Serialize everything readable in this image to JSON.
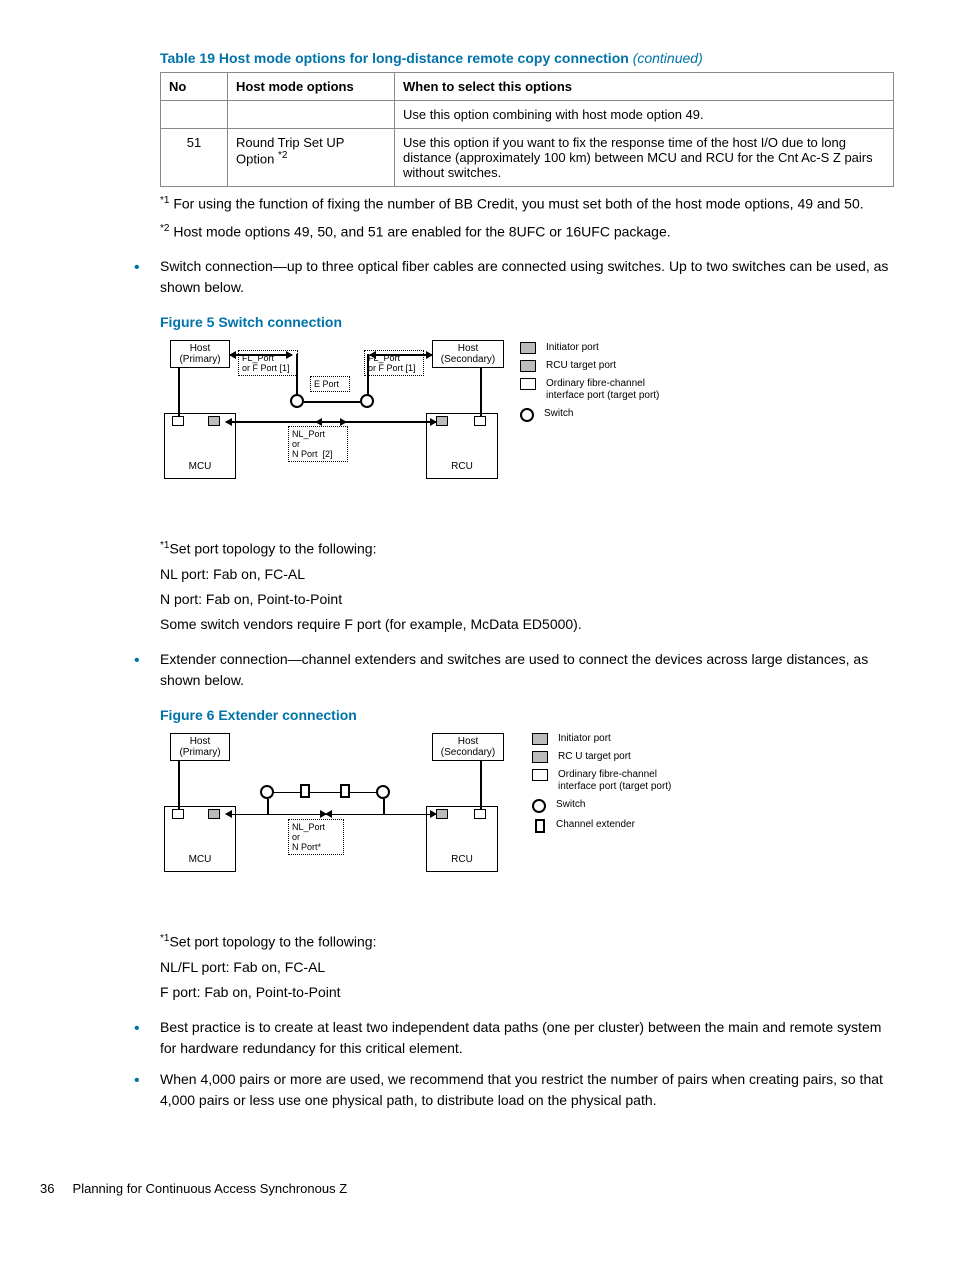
{
  "table19": {
    "caption_label": "Table 19 Host mode options for long-distance remote copy connection",
    "continued": "(continued)",
    "headers": {
      "no": "No",
      "opt": "Host mode options",
      "when": "When to select this options"
    },
    "rows": [
      {
        "no": "",
        "opt": "",
        "when": "Use this option combining with host mode option 49."
      },
      {
        "no": "51",
        "opt_html": "Round Trip Set UP Option",
        "opt_sup": "*2",
        "when": "Use this option if you want to fix the response time of the host I/O due to long distance (approximately 100 km) between MCU and RCU for the Cnt Ac-S Z pairs without switches."
      }
    ],
    "footnote1_sup": "*1",
    "footnote1": "For using the function of fixing the number of BB Credit, you must set both of the host mode options, 49 and 50.",
    "footnote2_sup": "*2",
    "footnote2": "Host mode options 49, 50, and 51 are enabled for the 8UFC or 16UFC package."
  },
  "bullet_switch_conn": "Switch connection—up to three optical fiber cables are connected using switches. Up to two switches can be used, as shown below.",
  "figure5": {
    "caption": "Figure 5 Switch connection",
    "host_primary": "Host\n(Primary)",
    "host_secondary": "Host\n(Secondary)",
    "fl_port1": "FL_Port\nor F Port [1]",
    "e_port": "E Port",
    "nl_port": "NL_Port\nor\nN Port  [2]",
    "mcu": "MCU",
    "rcu": "RCU",
    "legend": {
      "initiator": "Initiator port",
      "rcu_target": "RCU target port",
      "ordinary": "Ordinary fibre-channel interface port (target port)",
      "switch": "Switch"
    }
  },
  "fig5_notes": {
    "n1_sup": "*1",
    "n1": "Set port topology to the following:",
    "n2": "NL port: Fab on, FC-AL",
    "n3": "N port: Fab on, Point-to-Point",
    "n4": "Some switch vendors require F port (for example, McData ED5000)."
  },
  "bullet_extender_conn": "Extender connection—channel extenders and switches are used to connect the devices across large distances, as shown below.",
  "figure6": {
    "caption": "Figure 6 Extender connection",
    "host_primary": "Host\n(Primary)",
    "host_secondary": "Host\n(Secondary)",
    "nl_port": "NL_Port\nor\nN Port*",
    "mcu": "MCU",
    "rcu": "RCU",
    "legend": {
      "initiator": "Initiator port",
      "rcu_target": "RC U target port",
      "ordinary": "Ordinary fibre-channel interface port (target port)",
      "switch": "Switch",
      "extender": "Channel extender"
    }
  },
  "fig6_notes": {
    "n1_sup": "*1",
    "n1": "Set port topology to the following:",
    "n2": "NL/FL port: Fab on, FC-AL",
    "n3": "F port: Fab on, Point-to-Point"
  },
  "bullet_best_practice": "Best practice is to create at least two independent data paths (one per cluster) between the main and remote system for hardware redundancy for this critical element.",
  "bullet_pairs": "When 4,000 pairs or more are used, we recommend that you restrict the number of pairs when creating pairs, so that 4,000 pairs or less use one physical path, to distribute load on the physical path.",
  "footer": {
    "page": "36",
    "section": "Planning for Continuous Access Synchronous Z"
  }
}
